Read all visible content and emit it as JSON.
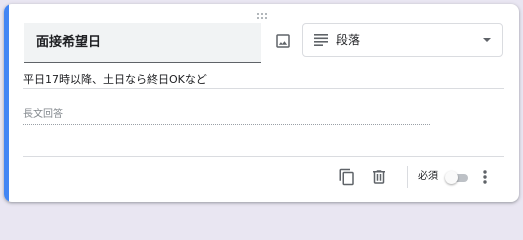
{
  "question": {
    "title": "面接希望日",
    "description": "平日17時以降、土日なら終日OKなど",
    "answer_placeholder": "長文回答"
  },
  "type_select": {
    "selected": "段落",
    "icon": "paragraph-icon"
  },
  "toolbar": {
    "image_icon": "image-icon",
    "duplicate_icon": "duplicate-icon",
    "delete_icon": "trash-icon",
    "required_label": "必須",
    "required": false,
    "more_icon": "more-vert-icon"
  },
  "colors": {
    "accent": "#4285f4",
    "background": "#e9e6f2",
    "icon": "#5f6368"
  }
}
